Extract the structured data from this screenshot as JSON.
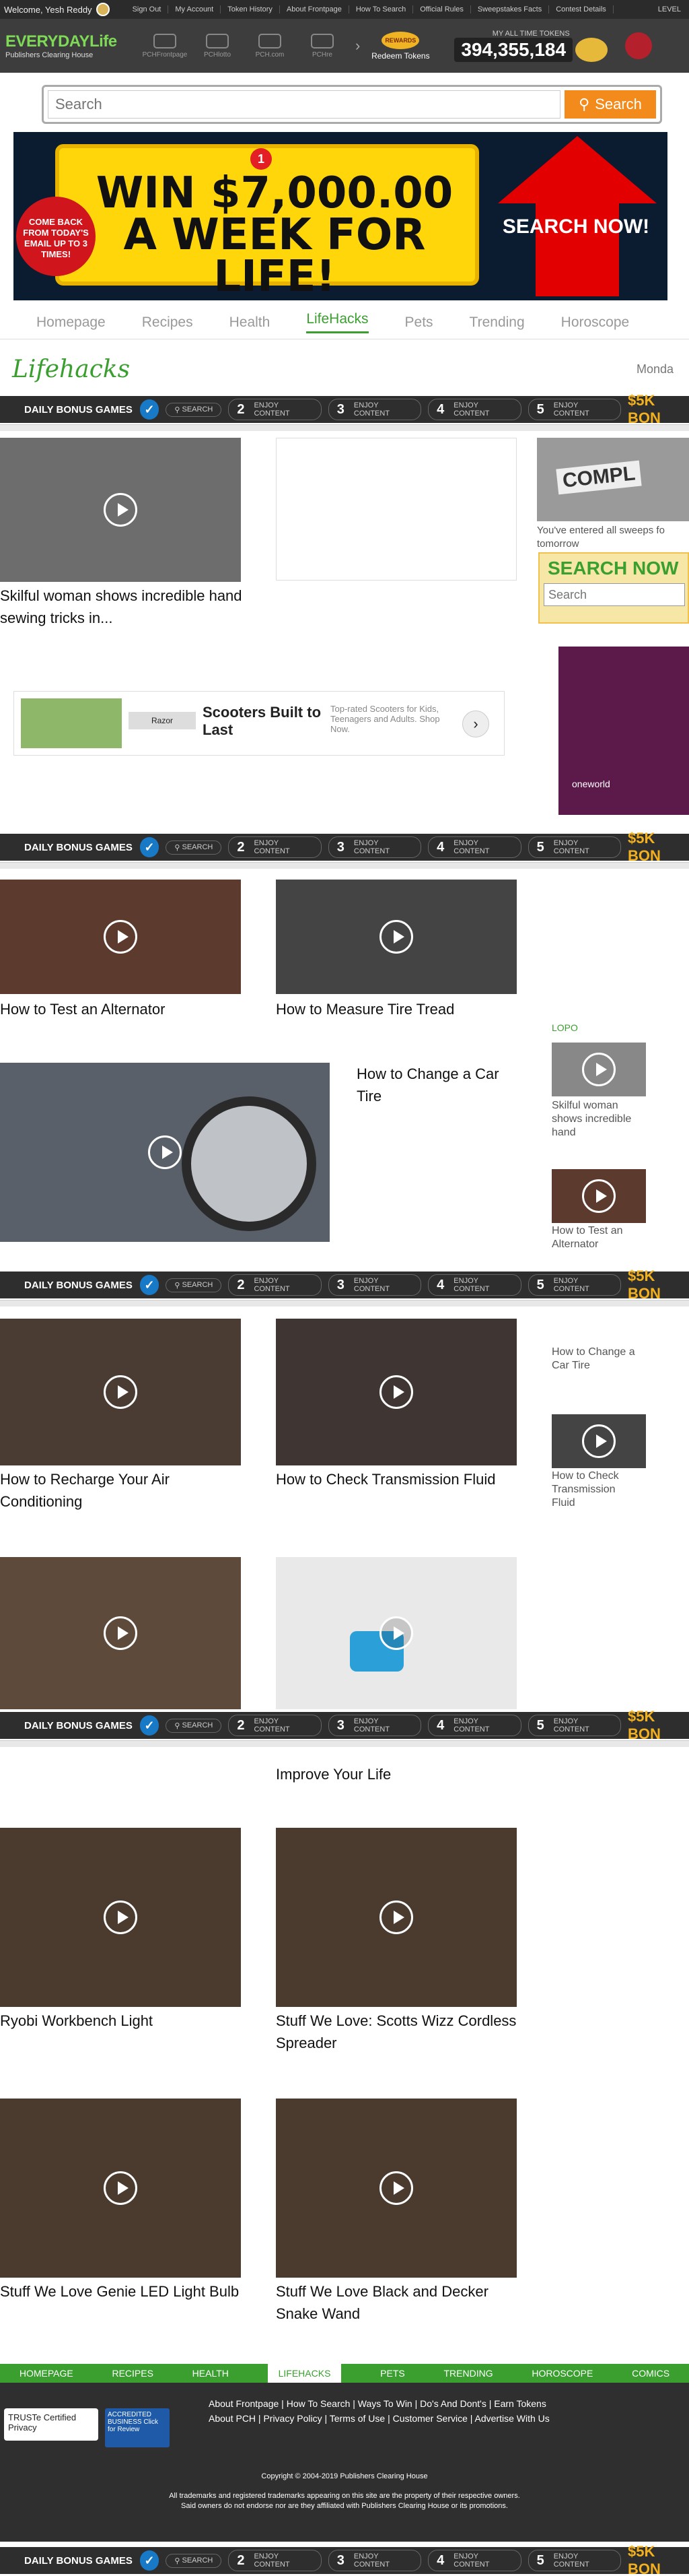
{
  "topbar": {
    "welcome": "Welcome, Yesh Reddy",
    "links": [
      "Sign Out",
      "My Account",
      "Token History",
      "About Frontpage",
      "How To Search",
      "Official Rules",
      "Sweepstakes Facts",
      "Contest Details"
    ],
    "level": "LEVEL"
  },
  "header": {
    "logo_main": "EVERYDAYLife",
    "logo_sub": "Publishers Clearing House",
    "nav": [
      "PCHFrontpage",
      "PCHlotto",
      "PCH.com",
      "PCHre"
    ],
    "redeem_badge": "REWARDS",
    "redeem_label": "Redeem Tokens",
    "tokens_label": "MY ALL TIME TOKENS",
    "tokens_value": "394,355,184"
  },
  "search": {
    "placeholder": "Search",
    "button": "Search"
  },
  "banner": {
    "badge": "1",
    "headline": "WIN $7,000.00 A WEEK FOR LIFE!",
    "seal": "COME BACK FROM TODAY'S EMAIL UP TO 3 TIMES!",
    "cta": "SEARCH NOW!"
  },
  "categories": [
    "Homepage",
    "Recipes",
    "Health",
    "LifeHacks",
    "Pets",
    "Trending",
    "Horoscope"
  ],
  "section_title": "Lifehacks",
  "date": "Monda",
  "bonus_bar": {
    "title": "DAILY BONUS GAMES",
    "steps": [
      {
        "n": "",
        "label": "SEARCH"
      },
      {
        "n": "2",
        "label": "ENJOY CONTENT"
      },
      {
        "n": "3",
        "label": "ENJOY CONTENT"
      },
      {
        "n": "4",
        "label": "ENJOY CONTENT"
      },
      {
        "n": "5",
        "label": "ENJOY CONTENT"
      }
    ],
    "bonus": "$5K BON"
  },
  "first_card": {
    "title": "Skilful woman shows incredible hand sewing tricks in..."
  },
  "sweeps": {
    "complete": "COMPL",
    "entered": "You've entered all sweeps fo tomorrow",
    "search_now": "SEARCH NOW",
    "placeholder": "Search"
  },
  "scooter_ad": {
    "brand": "Razor",
    "headline": "Scooters Built to Last",
    "copy": "Top-rated Scooters for Kids, Teenagers and Adults. Shop Now."
  },
  "side_ad": "oneworld",
  "cards": [
    "How to Test an Alternator",
    "How to Measure Tire Tread",
    "How to Change a Car Tire",
    "How to Recharge Your Air Conditioning",
    "How to Check Transmission Fluid",
    "Improve Your Life",
    "Ryobi Workbench Light",
    "Stuff We Love: Scotts Wizz Cordless Spreader",
    "Stuff We Love Genie LED Light Bulb",
    "Stuff We Love Black and Decker Snake Wand"
  ],
  "sidebar": {
    "label": "LOPO",
    "items": [
      "Skilful woman shows incredible hand",
      "How to Test an Alternator",
      "How to Change a Car Tire",
      "How to Check Transmission Fluid"
    ]
  },
  "footer": {
    "nav": [
      "HOMEPAGE",
      "RECIPES",
      "HEALTH",
      "LIFEHACKS",
      "PETS",
      "TRENDING",
      "HOROSCOPE",
      "COMICS"
    ],
    "links_row1": "About Frontpage  |  How To Search  |  Ways To Win  |  Do's And Dont's  |  Earn Tokens",
    "links_row2": "About PCH  |  Privacy Policy  |  Terms of Use  |  Customer Service  |  Advertise With Us",
    "trust": "TRUSTe Certified Privacy",
    "bbb": "ACCREDITED BUSINESS Click for Review",
    "copyright": "Copyright © 2004-2019 Publishers Clearing House",
    "legal1": "All trademarks and registered trademarks appearing on this site are the property of their respective owners.",
    "legal2": "Said owners do not endorse nor are they affiliated with Publishers Clearing House or its promotions."
  }
}
